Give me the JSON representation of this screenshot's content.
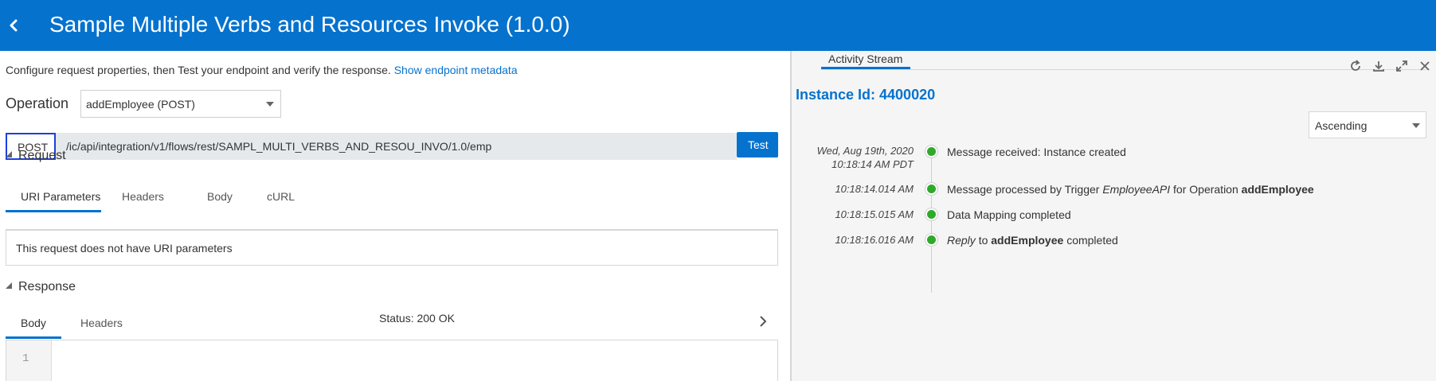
{
  "header": {
    "title": "Sample Multiple Verbs and Resources Invoke (1.0.0)"
  },
  "left": {
    "intro_text": "Configure request properties, then Test your endpoint and verify the response.",
    "metadata_link": "Show endpoint metadata",
    "operation_label": "Operation",
    "operation_value": "addEmployee (POST)",
    "method": "POST",
    "url": "/ic/api/integration/v1/flows/rest/SAMPL_MULTI_VERBS_AND_RESOU_INVO/1.0/emp",
    "test_label": "Test",
    "request": {
      "title": "Request",
      "tabs": [
        "URI Parameters",
        "Headers",
        "Body",
        "cURL"
      ],
      "message": "This request does not have URI parameters"
    },
    "response": {
      "title": "Response",
      "tabs": [
        "Body",
        "Headers"
      ],
      "status_label": "Status:",
      "status_value": "200 OK",
      "line_number": "1"
    }
  },
  "activity": {
    "tab_label": "Activity Stream",
    "instance_label": "Instance Id: 4400020",
    "sort_value": "Ascending",
    "events": [
      {
        "date": "Wed, Aug 19th, 2020",
        "time": "10:18:14 AM PDT",
        "text": "Message received: Instance created"
      },
      {
        "time": "10:18:14.014 AM",
        "text_pre": "Message processed by Trigger",
        "text_italic": "EmployeeAPI",
        "text_mid": "for Operation",
        "text_bold": "addEmployee"
      },
      {
        "time": "10:18:15.015 AM",
        "text": "Data Mapping completed"
      },
      {
        "time": "10:18:16.016 AM",
        "text_italic": "Reply",
        "text_mid": "to",
        "text_bold": "addEmployee",
        "text_post": "completed"
      }
    ]
  },
  "icons": {
    "back": "chevron-left-icon",
    "refresh": "refresh-icon",
    "download": "download-icon",
    "expand": "expand-icon",
    "close": "close-icon",
    "response_nav": "chevron-right-icon"
  },
  "colors": {
    "header": "#0572ce",
    "accent": "#0572ce",
    "success_dot": "#2eaa2a",
    "method_border": "#1a3fe0"
  }
}
